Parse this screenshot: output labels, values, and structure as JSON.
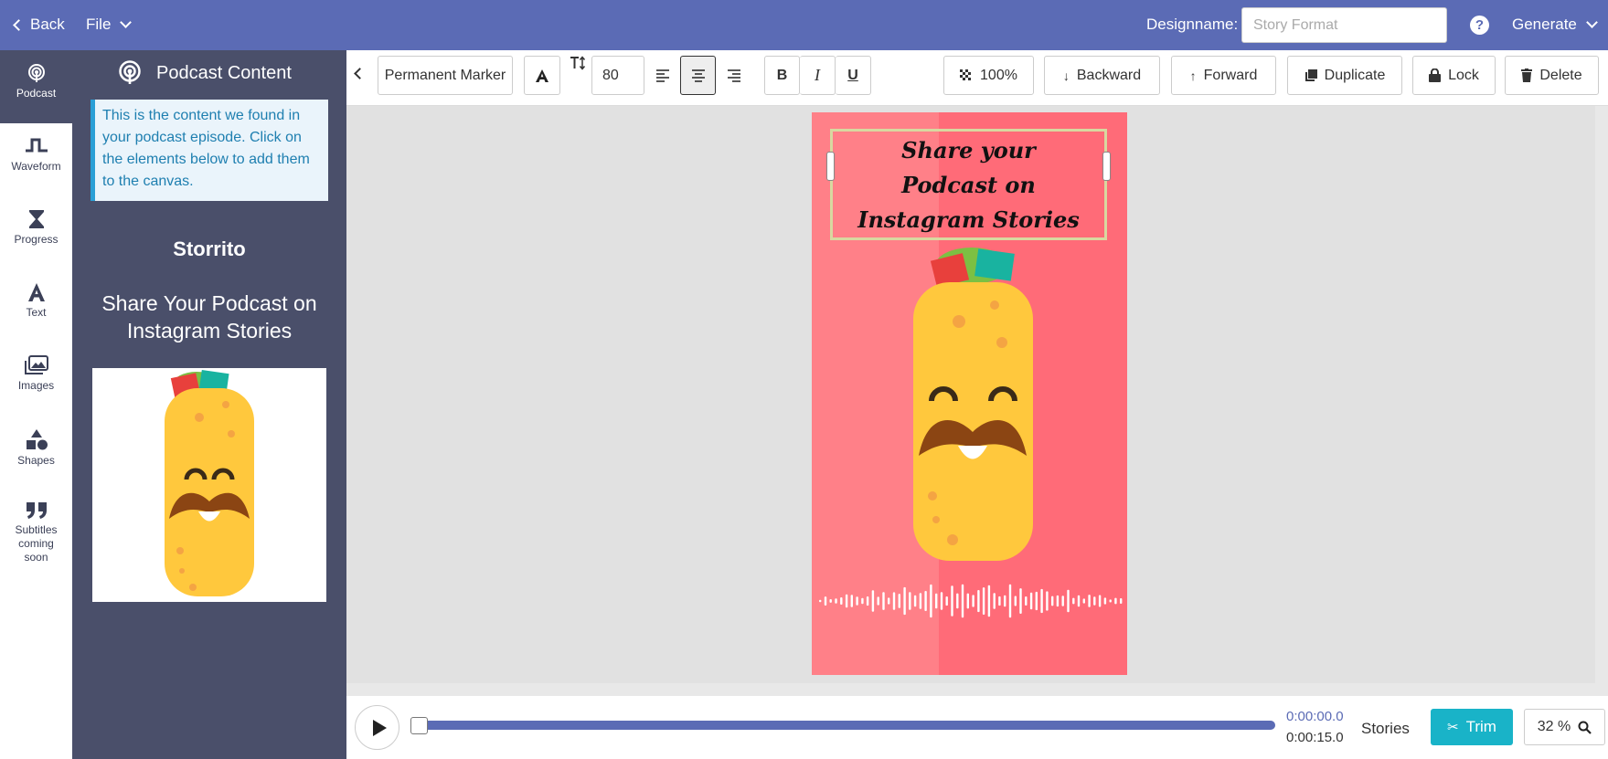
{
  "topbar": {
    "back_label": "Back",
    "file_label": "File",
    "designname_label": "Designname:",
    "designname_placeholder": "Story Format",
    "help_label": "?",
    "generate_label": "Generate"
  },
  "iconbar": {
    "items": [
      {
        "label": "Podcast",
        "icon": "podcast-icon"
      },
      {
        "label": "Waveform",
        "icon": "waveform-icon"
      },
      {
        "label": "Progress",
        "icon": "hourglass-icon"
      },
      {
        "label": "Text",
        "icon": "text-icon"
      },
      {
        "label": "Images",
        "icon": "images-icon"
      },
      {
        "label": "Shapes",
        "icon": "shapes-icon"
      },
      {
        "label": "Subtitles coming soon",
        "icon": "quote-icon"
      }
    ]
  },
  "panel": {
    "title": "Podcast Content",
    "info_text": "This is the content we found in your podcast episode. Click on the elements below to add them to the canvas.",
    "show_title": "Storrito",
    "episode_title": "Share Your Podcast on Instagram Stories"
  },
  "toolbar": {
    "font_family": "Permanent Marker",
    "font_size": "80",
    "opacity": "100%",
    "backward_label": "Backward",
    "forward_label": "Forward",
    "duplicate_label": "Duplicate",
    "lock_label": "Lock",
    "delete_label": "Delete",
    "text_align": "center"
  },
  "canvas": {
    "text_line1": "Share your",
    "text_line2": "Podcast on",
    "text_line3": "Instagram Stories",
    "background_color": "#ff6b78",
    "background_left_color": "#ff8088"
  },
  "player": {
    "current_time": "0:00:00.0",
    "total_time": "0:00:15.0",
    "progress": 0,
    "format": "Stories",
    "trim_label": "Trim",
    "zoom": "32 %"
  },
  "colors": {
    "brand": "#5b6bb5",
    "panel": "#4a4f6a",
    "accent": "#19b3c8"
  }
}
